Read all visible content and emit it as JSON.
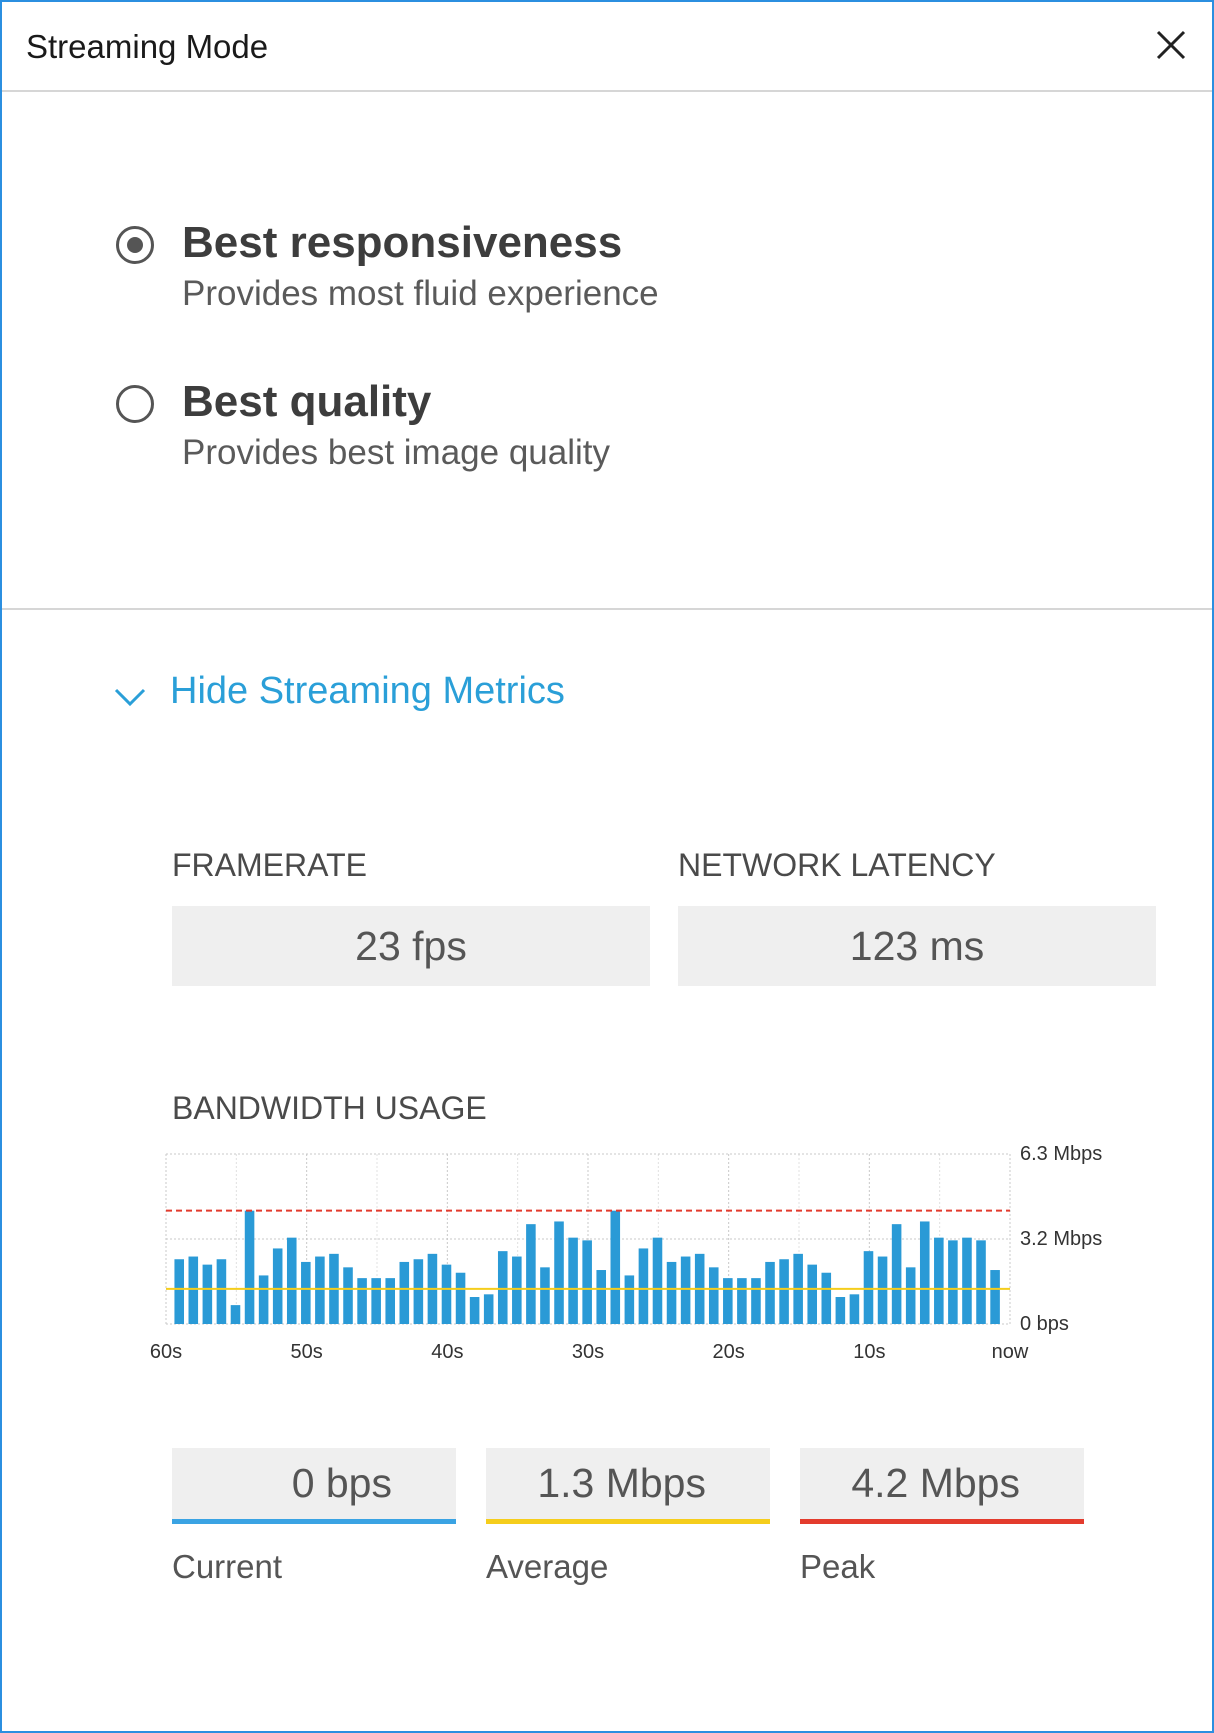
{
  "window": {
    "title": "Streaming Mode",
    "close_icon": "close-icon"
  },
  "modes": [
    {
      "label": "Best responsiveness",
      "description": "Provides most fluid experience",
      "selected": true
    },
    {
      "label": "Best quality",
      "description": "Provides best image quality",
      "selected": false
    }
  ],
  "metrics_toggle": {
    "label": "Hide Streaming Metrics",
    "icon": "chevron-down-icon"
  },
  "framerate": {
    "label": "FRAMERATE",
    "value": "23 fps"
  },
  "latency": {
    "label": "NETWORK LATENCY",
    "value": "123 ms"
  },
  "bandwidth": {
    "label": "BANDWIDTH USAGE",
    "current": {
      "value": "0 bps",
      "label": "Current",
      "color": "#3aa3e3"
    },
    "average": {
      "value": "1.3 Mbps",
      "label": "Average",
      "color": "#f5cd1c"
    },
    "peak": {
      "value": "4.2 Mbps",
      "label": "Peak",
      "color": "#e33b2d"
    }
  },
  "colors": {
    "accent": "#2a9fd8",
    "bar": "#2a9ad6",
    "window_border": "#2b8fe0"
  },
  "chart_data": {
    "type": "bar",
    "x_tick_labels": [
      "60s",
      "50s",
      "40s",
      "30s",
      "20s",
      "10s",
      "now"
    ],
    "y_tick_labels": [
      "6.3 Mbps",
      "3.2 Mbps",
      "0 bps"
    ],
    "ylim": [
      0,
      6.3
    ],
    "unit": "Mbps",
    "grid": true,
    "peak_line": 4.2,
    "average_line": 1.3,
    "values": [
      2.4,
      2.5,
      2.2,
      2.4,
      0.7,
      4.2,
      1.8,
      2.8,
      3.2,
      2.3,
      2.5,
      2.6,
      2.1,
      1.7,
      1.7,
      1.7,
      2.3,
      2.4,
      2.6,
      2.2,
      1.9,
      1.0,
      1.1,
      2.7,
      2.5,
      3.7,
      2.1,
      3.8,
      3.2,
      3.1,
      2.0,
      4.2,
      1.8,
      2.8,
      3.2,
      2.3,
      2.5,
      2.6,
      2.1,
      1.7,
      1.7,
      1.7,
      2.3,
      2.4,
      2.6,
      2.2,
      1.9,
      1.0,
      1.1,
      2.7,
      2.5,
      3.7,
      2.1,
      3.8,
      3.2,
      3.1,
      3.2,
      3.1,
      2.0
    ]
  }
}
